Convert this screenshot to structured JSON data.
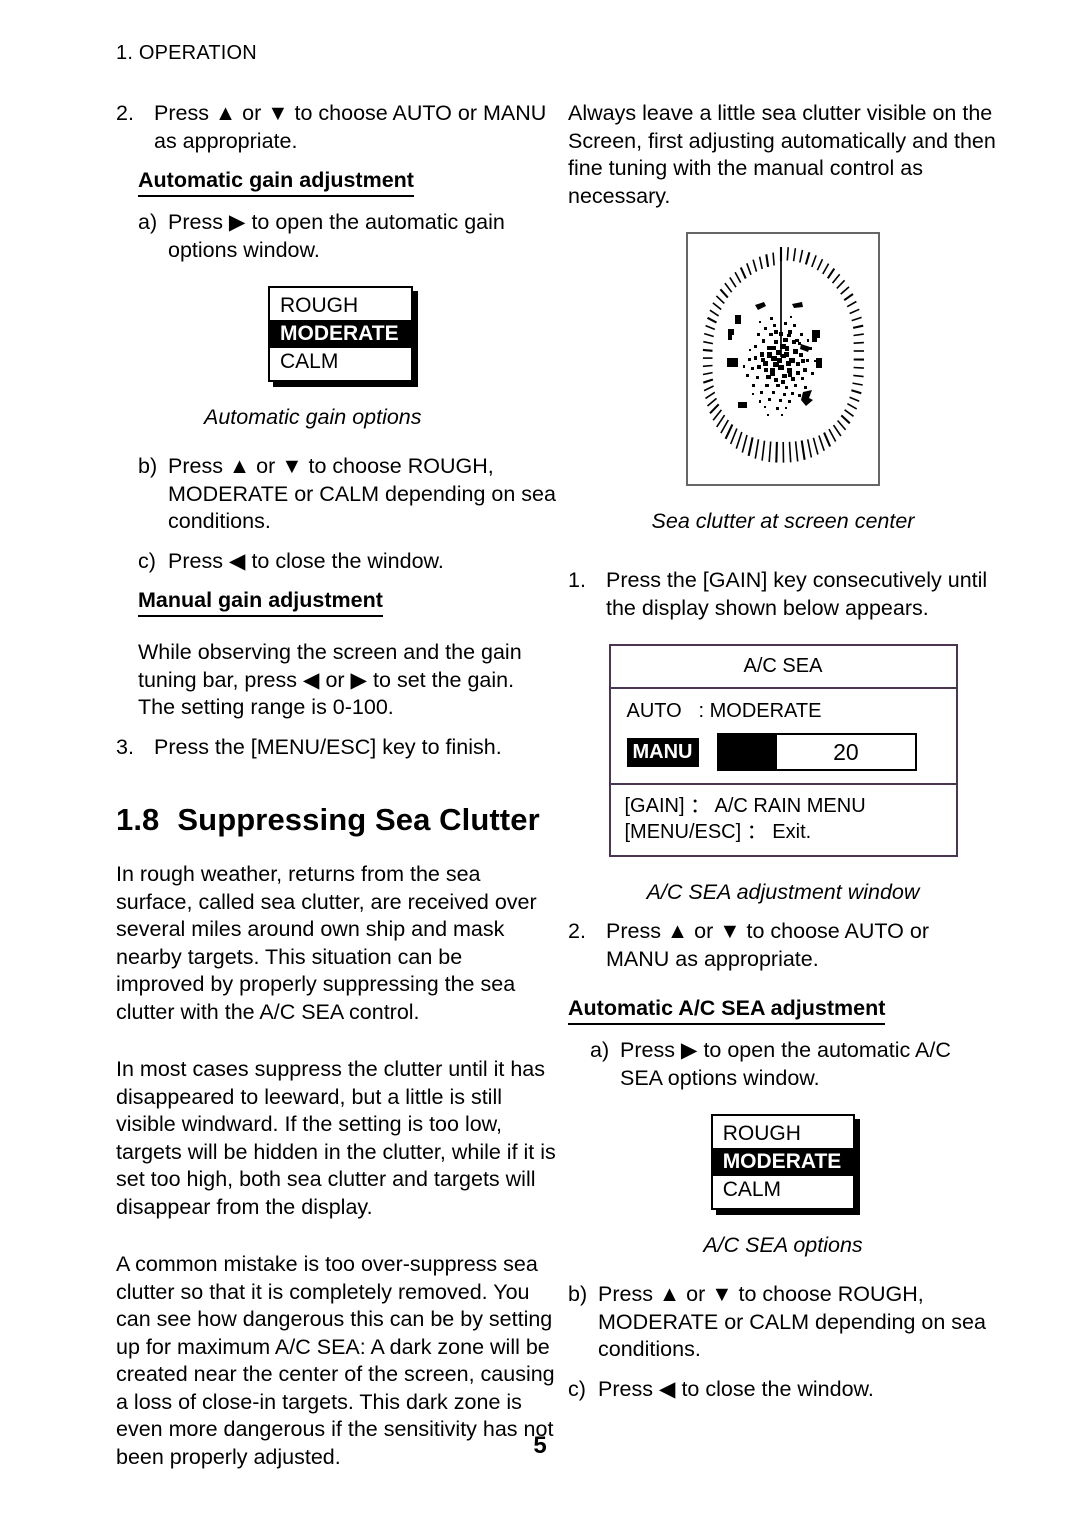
{
  "header": {
    "running_head": "1. OPERATION"
  },
  "page": {
    "number": "5"
  },
  "left_column": {
    "step2": {
      "marker": "2.",
      "text": "Press ▲ or ▼ to choose AUTO or MANU as appropriate."
    },
    "auto_gain_heading": "Automatic gain adjustment",
    "step_a": {
      "marker": "a)",
      "text": "Press ▶ to open the automatic gain options window."
    },
    "gain_options_box": {
      "options": [
        "ROUGH",
        "MODERATE",
        "CALM"
      ],
      "selected": "MODERATE"
    },
    "gain_options_caption": "Automatic gain options",
    "step_b": {
      "marker": "b)",
      "text": "Press ▲ or ▼ to choose ROUGH, MODERATE or CALM depending on sea conditions."
    },
    "step_c": {
      "marker": "c)",
      "text": "Press ◀ to close the window."
    },
    "manual_gain_heading": "Manual gain adjustment",
    "manual_gain_body": "While observing the screen and the gain tuning bar, press ◀ or ▶ to set the gain. The setting range is 0-100.",
    "step3": {
      "marker": "3.",
      "text": "Press the [MENU/ESC] key to finish."
    },
    "section": {
      "number": "1.8",
      "title": "Suppressing Sea Clutter"
    },
    "para1": "In rough weather, returns from the sea surface, called sea clutter, are received over several miles around own ship and mask nearby targets. This situation can be improved by properly suppressing the sea clutter with the A/C SEA control.",
    "para2": "In most cases suppress the clutter until it has disappeared to leeward, but a little is still visible windward. If the setting is too low, targets will be hidden in the clutter, while if it is set too high, both sea clutter and targets will disappear from the display.",
    "para3": "A common mistake is too over-suppress sea clutter so that it is completely removed. You can see how dangerous this can be by setting up for maximum A/C SEA: A dark zone will be created near the center of the screen, causing a loss of close-in targets. This dark zone is even more dangerous if the sensitivity has not been properly adjusted."
  },
  "right_column": {
    "intro_para": "Always leave a little sea clutter visible on the Screen, first adjusting automatically and then fine tuning with the manual control as necessary.",
    "radar_caption": "Sea clutter at screen center",
    "step1": {
      "marker": "1.",
      "text": "Press the [GAIN] key consecutively until the display shown below appears."
    },
    "acsea_window": {
      "title": "A/C SEA",
      "auto_label": "AUTO",
      "auto_value": ": MODERATE",
      "manu_label": "MANU",
      "manu_value": "20",
      "fill_percent": 30,
      "footer_line1": "[GAIN] ： A/C RAIN MENU",
      "footer_line2": "[MENU/ESC] ：  Exit."
    },
    "acsea_caption": "A/C SEA adjustment window",
    "step2": {
      "marker": "2.",
      "text": "Press ▲ or ▼ to choose AUTO or MANU as appropriate."
    },
    "auto_acsea_heading": "Automatic A/C SEA adjustment",
    "step_a": {
      "marker": "a)",
      "text": "Press ▶ to open the automatic A/C SEA options window."
    },
    "acsea_options_box": {
      "options": [
        "ROUGH",
        "MODERATE",
        "CALM"
      ],
      "selected": "MODERATE"
    },
    "acsea_options_caption": "A/C SEA options",
    "step_b": {
      "marker": "b)",
      "text": "Press ▲ or ▼ to choose ROUGH, MODERATE or CALM depending on sea conditions."
    },
    "step_c": {
      "marker": "c)",
      "text": "Press ◀ to close the window."
    }
  },
  "colors": {
    "text": "#000000",
    "window_border": "#4b3550",
    "radar_border": "#666666",
    "background": "#ffffff"
  }
}
